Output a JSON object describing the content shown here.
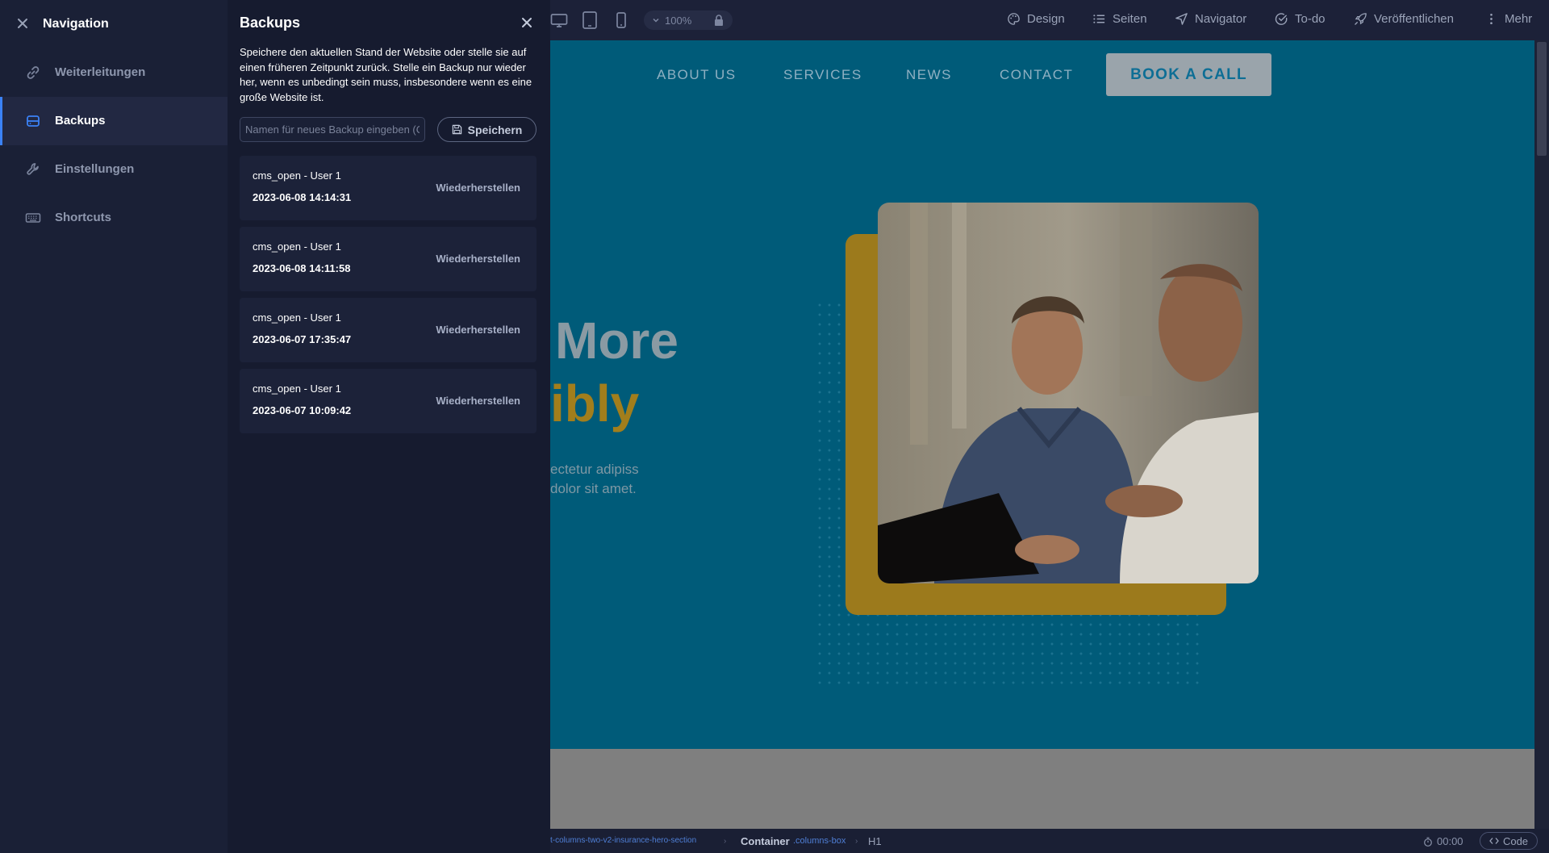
{
  "navigation": {
    "title": "Navigation",
    "items": [
      {
        "label": "Weiterleitungen",
        "icon": "link-icon",
        "active": false
      },
      {
        "label": "Backups",
        "icon": "database-icon",
        "active": true
      },
      {
        "label": "Einstellungen",
        "icon": "wrench-icon",
        "active": false
      },
      {
        "label": "Shortcuts",
        "icon": "keyboard-icon",
        "active": false
      }
    ]
  },
  "backups": {
    "title": "Backups",
    "description": "Speichere den aktuellen Stand der Website oder stelle sie auf einen früheren Zeitpunkt zurück. Stelle ein Backup nur wieder her, wenn es unbedingt sein muss, insbesondere wenn es eine große Website ist.",
    "input_placeholder": "Namen für neues Backup eingeben (Optional)",
    "save_label": "Speichern",
    "items": [
      {
        "user": "cms_open - User 1",
        "date": "2023-06-08 14:14:31",
        "action": "Wiederherstellen"
      },
      {
        "user": "cms_open - User 1",
        "date": "2023-06-08 14:11:58",
        "action": "Wiederherstellen"
      },
      {
        "user": "cms_open - User 1",
        "date": "2023-06-07 17:35:47",
        "action": "Wiederherstellen"
      },
      {
        "user": "cms_open - User 1",
        "date": "2023-06-07 10:09:42",
        "action": "Wiederherstellen"
      }
    ]
  },
  "topbar": {
    "zoom": "100%",
    "items": [
      {
        "label": "Design",
        "icon": "palette-icon"
      },
      {
        "label": "Seiten",
        "icon": "list-icon"
      },
      {
        "label": "Navigator",
        "icon": "navigator-arrow-icon"
      },
      {
        "label": "To-do",
        "icon": "check-circle-icon"
      },
      {
        "label": "Veröffentlichen",
        "icon": "rocket-icon"
      },
      {
        "label": "Mehr",
        "icon": "more-vertical-icon"
      }
    ]
  },
  "preview": {
    "menu": [
      "ABOUT US",
      "SERVICES",
      "NEWS",
      "CONTACT"
    ],
    "cta": "BOOK A CALL",
    "heading_line1": "More",
    "heading_line2": "ibly",
    "paragraph_line1": "ectetur adipiss",
    "paragraph_line2": "dolor sit amet."
  },
  "bottombar": {
    "breadcrumb_section": "t-columns-two-v2-insurance-hero-section",
    "breadcrumb_container": "Container",
    "breadcrumb_class": ".columns-box",
    "breadcrumb_tag": "H1",
    "timer": "00:00",
    "code_label": "Code"
  },
  "colors": {
    "accent": "#3b82f6",
    "panel_bg": "#161b2f",
    "hero_bg": "#005b79",
    "gold": "#9c7a1c"
  }
}
